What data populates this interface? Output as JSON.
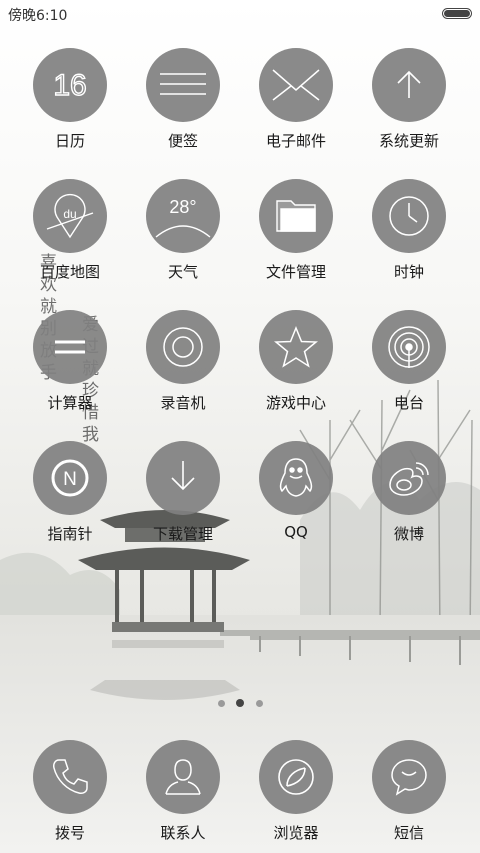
{
  "status_bar": {
    "time": "傍晚6:10"
  },
  "wallpaper": {
    "calligraphy": [
      "喜欢就别放手",
      "爱过就珍惜我"
    ]
  },
  "apps": [
    {
      "id": "calendar",
      "label": "日历",
      "icon": "calendar-icon",
      "text": "16"
    },
    {
      "id": "notes",
      "label": "便签",
      "icon": "notes-icon"
    },
    {
      "id": "email",
      "label": "电子邮件",
      "icon": "envelope-icon"
    },
    {
      "id": "system-update",
      "label": "系统更新",
      "icon": "arrow-up-icon"
    },
    {
      "id": "baidu-map",
      "label": "百度地图",
      "icon": "map-pin-icon",
      "text": "du"
    },
    {
      "id": "weather",
      "label": "天气",
      "icon": "weather-icon",
      "text": "28°"
    },
    {
      "id": "file-manager",
      "label": "文件管理",
      "icon": "folder-icon"
    },
    {
      "id": "clock",
      "label": "时钟",
      "icon": "clock-icon"
    },
    {
      "id": "calculator",
      "label": "计算器",
      "icon": "equals-icon"
    },
    {
      "id": "recorder",
      "label": "录音机",
      "icon": "record-icon"
    },
    {
      "id": "game-center",
      "label": "游戏中心",
      "icon": "star-icon"
    },
    {
      "id": "radio",
      "label": "电台",
      "icon": "radio-icon"
    },
    {
      "id": "compass",
      "label": "指南针",
      "icon": "compass-icon",
      "text": "N"
    },
    {
      "id": "download-manager",
      "label": "下载管理",
      "icon": "download-icon"
    },
    {
      "id": "qq",
      "label": "QQ",
      "icon": "qq-penguin-icon"
    },
    {
      "id": "weibo",
      "label": "微博",
      "icon": "weibo-icon"
    }
  ],
  "dock": [
    {
      "id": "dialer",
      "label": "拨号",
      "icon": "phone-icon"
    },
    {
      "id": "contacts",
      "label": "联系人",
      "icon": "contact-icon"
    },
    {
      "id": "browser",
      "label": "浏览器",
      "icon": "browser-icon"
    },
    {
      "id": "sms",
      "label": "短信",
      "icon": "message-icon"
    }
  ],
  "page_indicator": {
    "pages": 3,
    "current": 2
  },
  "colors": {
    "icon_bg": "#808080",
    "icon_fg": "#ffffff",
    "label": "#1a1a1a"
  }
}
